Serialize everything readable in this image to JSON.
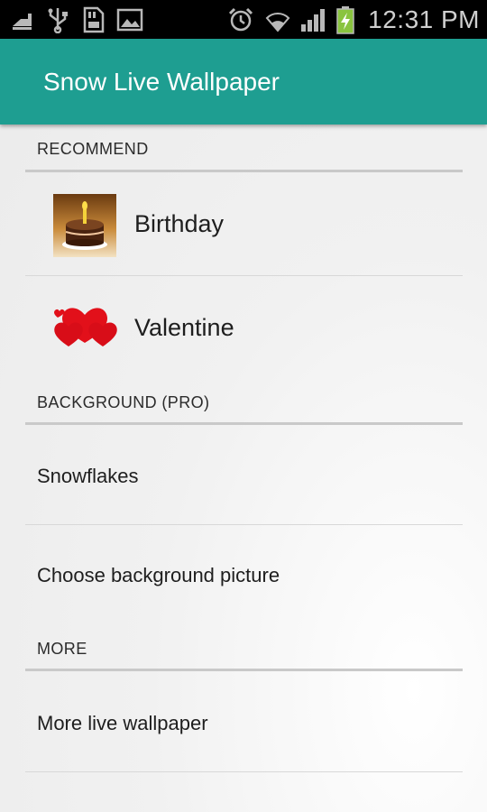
{
  "status_bar": {
    "time": "12:31 PM",
    "icons": [
      "usb-debug-icon",
      "usb-icon",
      "sdcard-icon",
      "gallery-icon",
      "alarm-icon",
      "wifi-icon",
      "signal-icon",
      "battery-charging-icon"
    ]
  },
  "app_bar": {
    "title": "Snow Live Wallpaper"
  },
  "sections": {
    "recommend": {
      "header": "RECOMMEND",
      "items": [
        {
          "label": "Birthday",
          "icon": "birthday-cake-icon"
        },
        {
          "label": "Valentine",
          "icon": "hearts-icon"
        }
      ]
    },
    "background": {
      "header": "BACKGROUND (PRO)",
      "items": [
        {
          "label": "Snowflakes"
        },
        {
          "label": "Choose background picture"
        }
      ]
    },
    "more": {
      "header": "MORE",
      "items": [
        {
          "label": "More live wallpaper"
        }
      ]
    }
  },
  "colors": {
    "app_bar": "#1e9e91",
    "status_bar": "#000000",
    "background": "#eeeeee",
    "heart": "#e2101a"
  }
}
